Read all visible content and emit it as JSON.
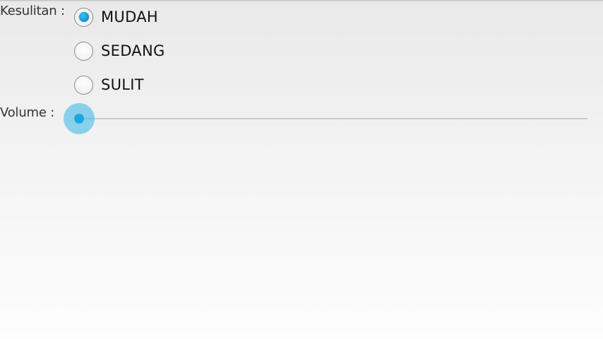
{
  "difficulty": {
    "label": "Kesulitan :",
    "options": [
      {
        "label": "MUDAH",
        "selected": true
      },
      {
        "label": "SEDANG",
        "selected": false
      },
      {
        "label": "SULIT",
        "selected": false
      }
    ]
  },
  "volume": {
    "label": "Volume :",
    "value": 0
  },
  "colors": {
    "accent": "#33b5e5",
    "radio_selected": "#1a9ad6",
    "track": "#c9c9c9"
  }
}
